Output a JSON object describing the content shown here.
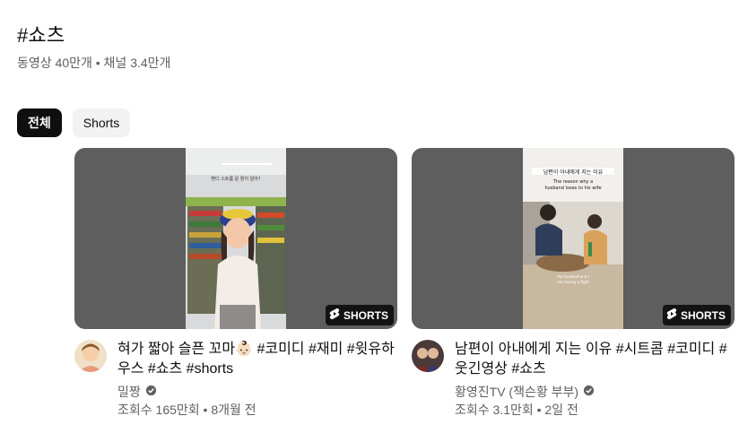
{
  "header": {
    "title": "#쇼츠",
    "stats": "동영상 40만개 • 채널 3.4만개"
  },
  "chips": [
    "전체",
    "Shorts"
  ],
  "videos": [
    {
      "title": "혀가 짧아 슬픈 꼬마👶🏻 #코미디 #재미 #윗유하우스 #쇼츠 #shorts",
      "channel": "밀짱",
      "views": "조회수 165만회 • 8개월 전",
      "badge": "SHORTS",
      "overlay_text": "뻔디 스트롬 문 뭔지 알아?"
    },
    {
      "title": "남편이 아내에게 지는 이유 #시트콤 #코미디 #웃긴영상 #쇼츠",
      "channel": "황영진TV (잭슨황 부부)",
      "views": "조회수 3.1만회 • 2일 전",
      "badge": "SHORTS",
      "overlay_text": "남편이 아내에게 지는 이유\nThe reason why a husband loses to his wife",
      "subtitle_text": "My husband and I are having a fight"
    }
  ],
  "colors": {
    "chip_active": "#0f0f0f",
    "chip_inactive": "#f2f2f2",
    "secondary_text": "#606060"
  }
}
